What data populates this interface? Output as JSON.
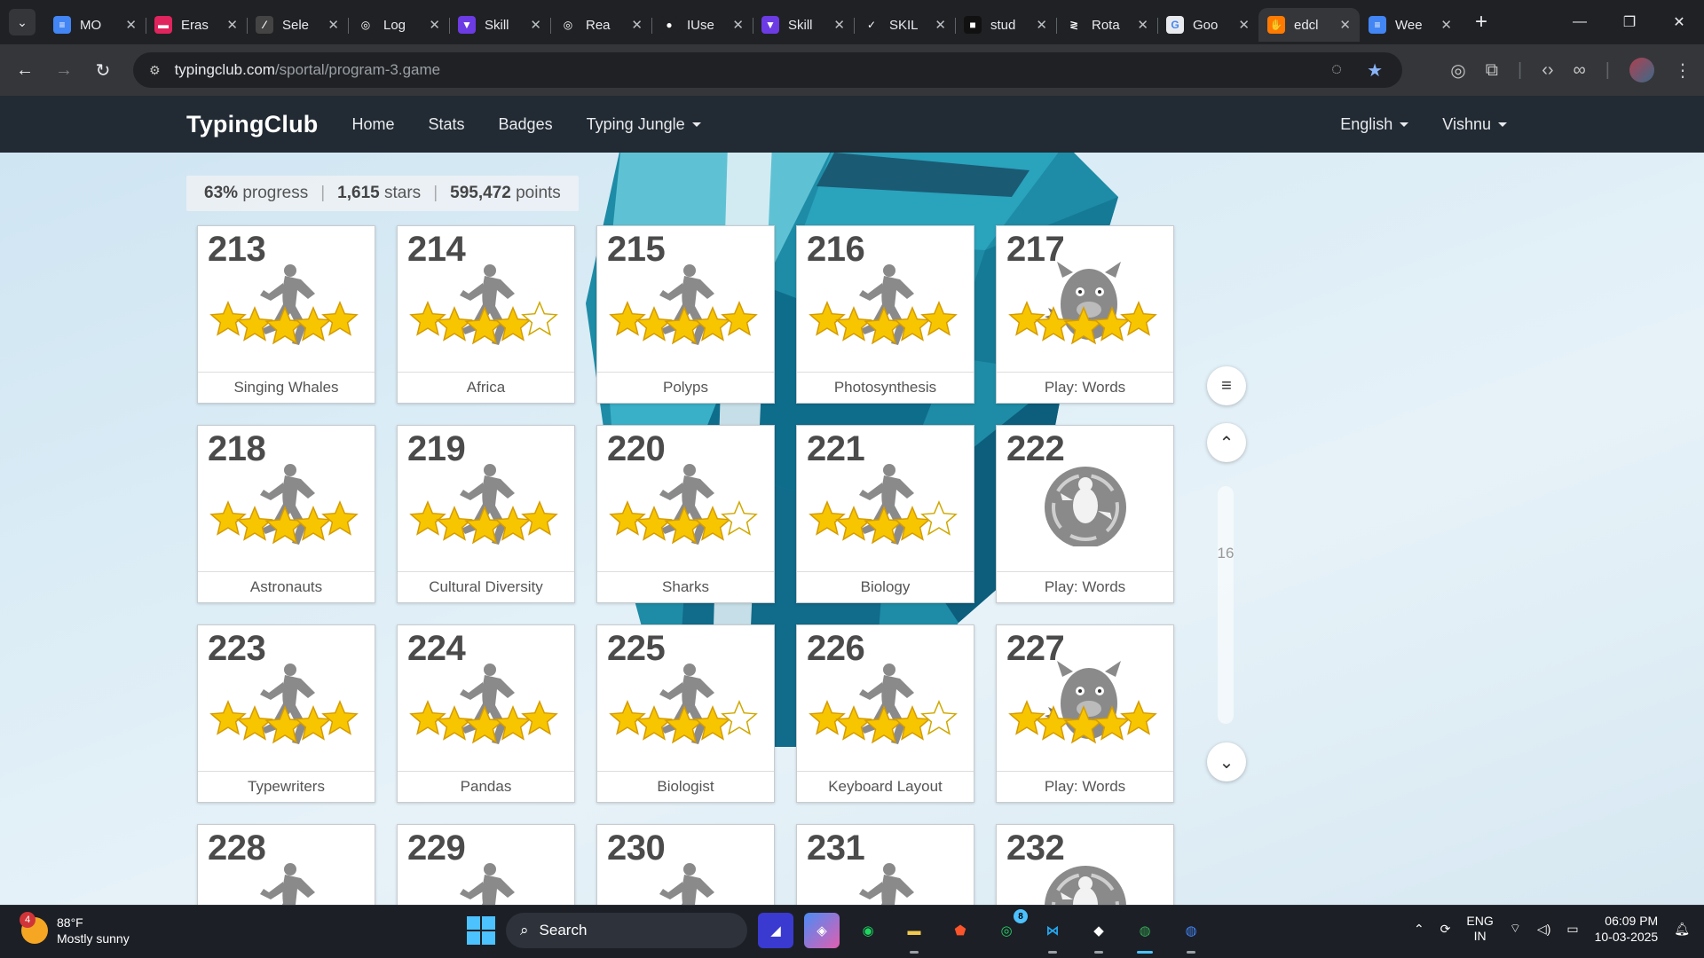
{
  "browser": {
    "tabs": [
      {
        "label": "MO",
        "fav": "docs",
        "color": "#4285f4",
        "glyph": "≡"
      },
      {
        "label": "Eras",
        "fav": "eraser",
        "color": "#e0245e",
        "glyph": "▬"
      },
      {
        "label": "Sele",
        "fav": "pen",
        "color": "#444",
        "glyph": "⁄"
      },
      {
        "label": "Log",
        "fav": "openai",
        "color": "#202124",
        "glyph": "◎"
      },
      {
        "label": "Skill",
        "fav": "skill",
        "color": "#6c3be4",
        "glyph": "▼"
      },
      {
        "label": "Rea",
        "fav": "openai",
        "color": "#202124",
        "glyph": "◎"
      },
      {
        "label": "IUse",
        "fav": "github",
        "color": "#202124",
        "glyph": "●"
      },
      {
        "label": "Skill",
        "fav": "skill",
        "color": "#6c3be4",
        "glyph": "▼"
      },
      {
        "label": "SKIL",
        "fav": "check",
        "color": "#202124",
        "glyph": "✓"
      },
      {
        "label": "stud",
        "fav": "studio",
        "color": "#111",
        "glyph": "■"
      },
      {
        "label": "Rota",
        "fav": "rotate",
        "color": "#202124",
        "glyph": "≷"
      },
      {
        "label": "Goo",
        "fav": "google",
        "color": "#e8eaed",
        "glyph": "G"
      },
      {
        "label": "edcl",
        "fav": "edclub",
        "color": "#ff7a00",
        "glyph": "✋",
        "active": true
      },
      {
        "label": "Wee",
        "fav": "docs",
        "color": "#4285f4",
        "glyph": "≡"
      }
    ],
    "url_host": "typingclub.com",
    "url_path": "/sportal/program-3.game"
  },
  "site": {
    "brand": "TypingClub",
    "nav": {
      "home": "Home",
      "stats": "Stats",
      "badges": "Badges",
      "jungle": "Typing Jungle"
    },
    "language": "English",
    "user": "Vishnu"
  },
  "summary": {
    "progress_value": "63%",
    "progress_label": "progress",
    "stars_value": "1,615",
    "stars_label": "stars",
    "points_value": "595,472",
    "points_label": "points"
  },
  "lessons": [
    {
      "num": "213",
      "name": "Singing Whales",
      "kind": "runner",
      "stars": 5
    },
    {
      "num": "214",
      "name": "Africa",
      "kind": "runner",
      "stars": 4
    },
    {
      "num": "215",
      "name": "Polyps",
      "kind": "runner",
      "stars": 5
    },
    {
      "num": "216",
      "name": "Photosynthesis",
      "kind": "runner",
      "stars": 5
    },
    {
      "num": "217",
      "name": "Play: Words",
      "kind": "monster",
      "stars": 5
    },
    {
      "num": "218",
      "name": "Astronauts",
      "kind": "runner",
      "stars": 5
    },
    {
      "num": "219",
      "name": "Cultural Diversity",
      "kind": "runner",
      "stars": 5
    },
    {
      "num": "220",
      "name": "Sharks",
      "kind": "runner",
      "stars": 4
    },
    {
      "num": "221",
      "name": "Biology",
      "kind": "runner",
      "stars": 4
    },
    {
      "num": "222",
      "name": "Play: Words",
      "kind": "locked",
      "stars": 0
    },
    {
      "num": "223",
      "name": "Typewriters",
      "kind": "runner",
      "stars": 5
    },
    {
      "num": "224",
      "name": "Pandas",
      "kind": "runner",
      "stars": 5
    },
    {
      "num": "225",
      "name": "Biologist",
      "kind": "runner",
      "stars": 4
    },
    {
      "num": "226",
      "name": "Keyboard Layout",
      "kind": "runner",
      "stars": 4
    },
    {
      "num": "227",
      "name": "Play: Words",
      "kind": "monster",
      "stars": 5
    },
    {
      "num": "228",
      "name": "",
      "kind": "runner",
      "stars": 0
    },
    {
      "num": "229",
      "name": "",
      "kind": "runner",
      "stars": 0
    },
    {
      "num": "230",
      "name": "",
      "kind": "runner",
      "stars": 0
    },
    {
      "num": "231",
      "name": "",
      "kind": "runner",
      "stars": 0
    },
    {
      "num": "232",
      "name": "",
      "kind": "locked",
      "stars": 0
    }
  ],
  "scroller": {
    "page": "16"
  },
  "taskbar": {
    "temp": "88°F",
    "condition": "Mostly sunny",
    "weather_badge": "4",
    "search": "Search",
    "lang1": "ENG",
    "lang2": "IN",
    "time": "06:09 PM",
    "date": "10-03-2025",
    "whatsapp_badge": "8"
  },
  "colors": {
    "nav_bg": "#222a33",
    "star_fill": "#f7c600",
    "star_empty": "#ffffff",
    "figure_gray": "#8a8a8a"
  }
}
